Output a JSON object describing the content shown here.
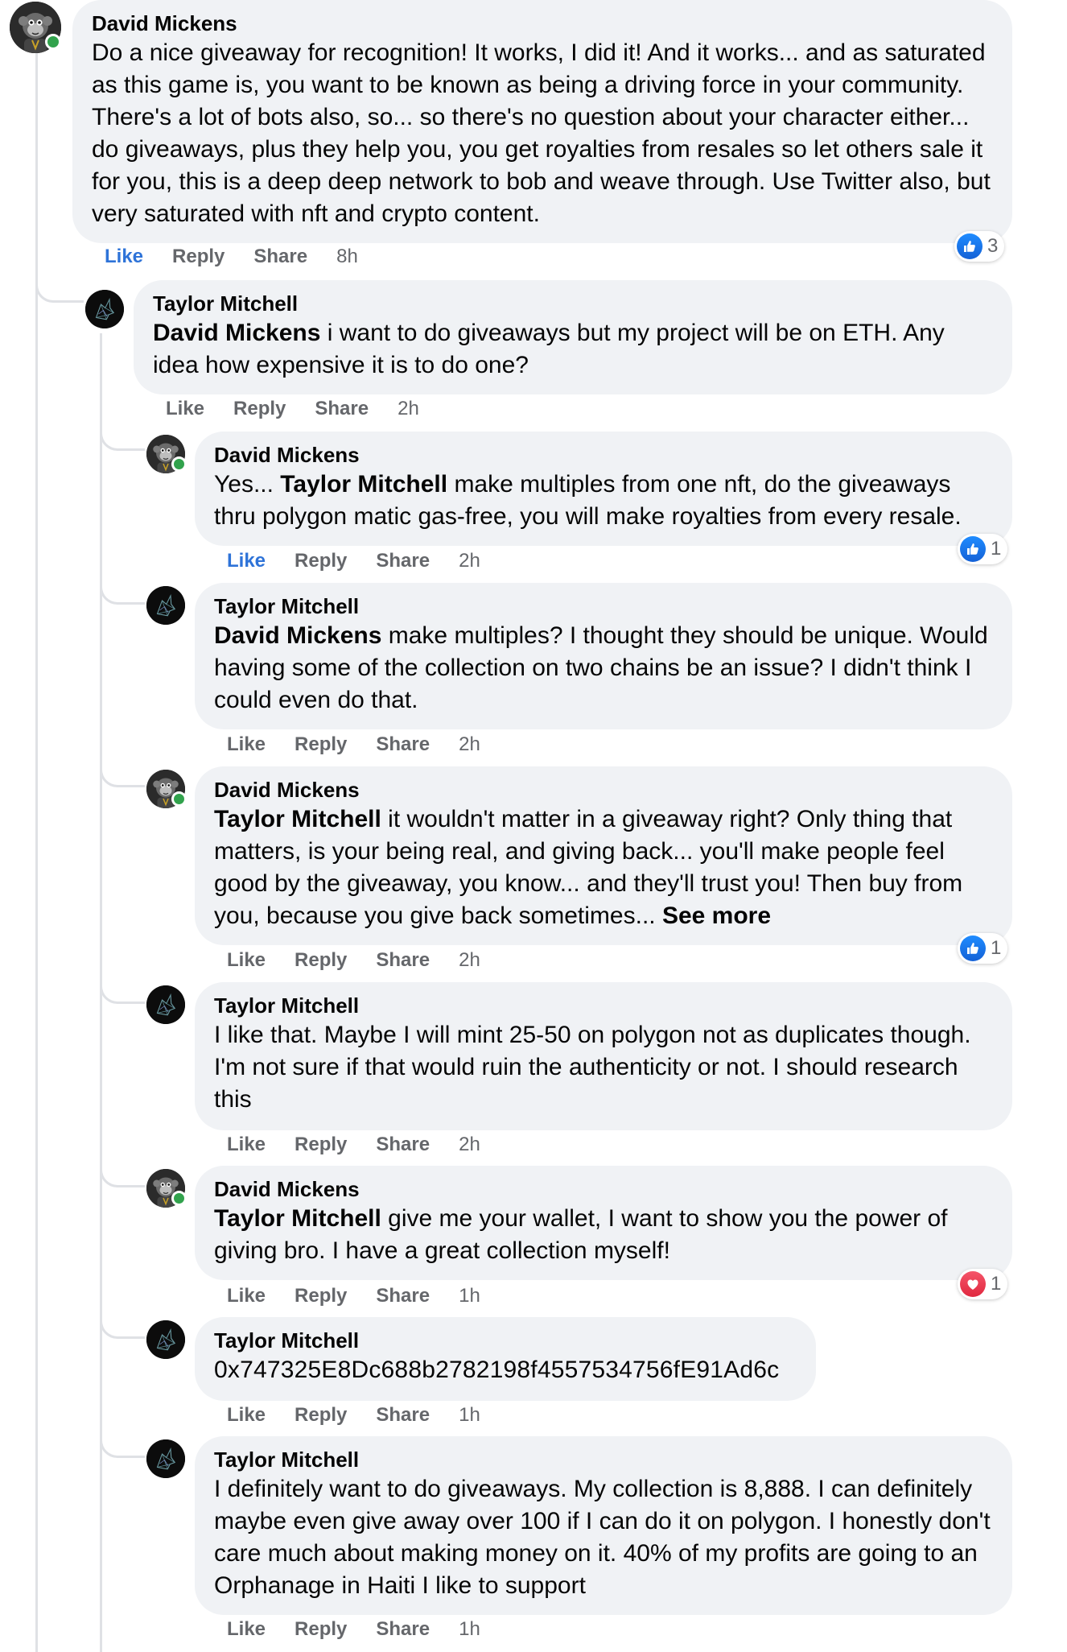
{
  "actions": {
    "like": "Like",
    "reply": "Reply",
    "share": "Share"
  },
  "comments": [
    {
      "author": "David Mickens",
      "text": "Do a nice giveaway for recognition! It works, I did it! And it works... and as saturated as this game is, you want to be known as being a driving force in your community. There's a lot of bots also, so... so there's no question about your character either... do giveaways, plus they help you, you get royalties from resales so let others sale it for you, this is a deep deep network to bob and weave through. Use Twitter also, but very saturated with nft and crypto content.",
      "time": "8h",
      "liked": true,
      "reaction": "like",
      "reaction_count": "3",
      "avatar": "monkey-avatar"
    },
    {
      "author": "Taylor Mitchell",
      "mention": "David Mickens",
      "text": " i want to do giveaways but my project will be on ETH. Any idea how expensive it is to do one?",
      "time": "2h",
      "avatar": "unicorn-avatar"
    },
    {
      "author": "David Mickens",
      "prefix": "Yes... ",
      "mention": "Taylor Mitchell",
      "text": " make multiples from one nft, do the giveaways thru polygon matic gas-free, you will make royalties from every resale.",
      "time": "2h",
      "liked": true,
      "reaction": "like",
      "reaction_count": "1"
    },
    {
      "author": "Taylor Mitchell",
      "mention": "David Mickens",
      "text": " make multiples? I thought they should be unique. Would having some of the collection on two chains be an issue? I didn't think I could even do that.",
      "time": "2h"
    },
    {
      "author": "David Mickens",
      "mention": "Taylor Mitchell",
      "text": " it wouldn't matter in a giveaway right? Only thing that matters, is your being real, and giving back... you'll make people feel good by the giveaway, you know... and they'll trust you! Then buy from you, because you give back sometimes... ",
      "see_more": "See more",
      "time": "2h",
      "reaction": "like",
      "reaction_count": "1"
    },
    {
      "author": "Taylor Mitchell",
      "text": "I like that. Maybe I will mint 25-50 on polygon not as duplicates though. I'm not sure if that would ruin the authenticity or not. I should research this",
      "time": "2h"
    },
    {
      "author": "David Mickens",
      "mention": "Taylor Mitchell",
      "text": " give me your wallet, I want to show you the power of giving bro. I have a great collection myself!",
      "time": "1h",
      "reaction": "love",
      "reaction_count": "1"
    },
    {
      "author": "Taylor Mitchell",
      "text": "0x747325E8Dc688b2782198f4557534756fE91Ad6c",
      "time": "1h"
    },
    {
      "author": "Taylor Mitchell",
      "text": "I definitely want to do giveaways. My collection is 8,888. I can definitely maybe even give away over 100 if I can do it on polygon. I honestly don't care much about making money on it. 40% of my profits are going to an Orphanage in Haiti I like to support",
      "time": "1h"
    }
  ],
  "colors": {
    "link_blue": "#2e73d8",
    "bubble": "#f0f2f5",
    "meta_grey": "#65676b",
    "online_green": "#31a24c"
  }
}
